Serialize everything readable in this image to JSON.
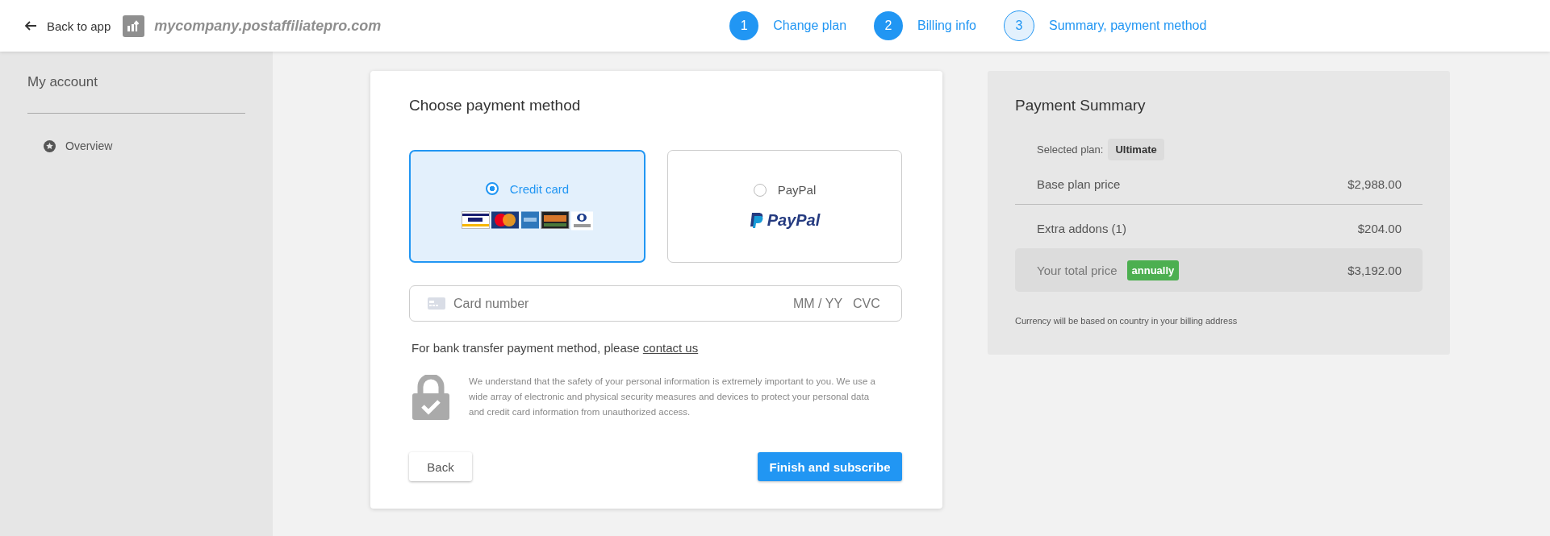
{
  "header": {
    "back_label": "Back to app",
    "site": "mycompany.postaffiliatepro.com",
    "steps": [
      {
        "number": "1",
        "label": "Change plan",
        "kind": "done"
      },
      {
        "number": "2",
        "label": "Billing info",
        "kind": "done"
      },
      {
        "number": "3",
        "label": "Summary, payment method",
        "kind": "current"
      }
    ]
  },
  "sidebar": {
    "title": "My account",
    "items": [
      {
        "label": "Overview",
        "selected": false
      }
    ]
  },
  "payment": {
    "title": "Choose payment method",
    "methods": [
      {
        "label": "Credit card",
        "kind": "cards",
        "selected": true
      },
      {
        "label": "PayPal",
        "kind": "paypal",
        "logo_text": "PayPal",
        "selected": false
      }
    ],
    "card_field": {
      "placeholder": "Card number",
      "expiry_placeholder": "MM / YY",
      "cvc_placeholder": "CVC"
    },
    "bank_note": "For bank transfer payment method, please ",
    "bank_link": "contact us",
    "security_text": "We understand that the safety of your personal information is extremely important to you. We use a wide array of electronic and physical security measures and devices to protect your personal data and credit card information from unauthorized access.",
    "back_button": "Back",
    "finish_button": "Finish and subscribe"
  },
  "summary": {
    "title": "Payment Summary",
    "plan_label": "Selected plan:",
    "plan": "Ultimate",
    "rows": [
      {
        "label": "Base plan price",
        "value": "$2,988.00"
      },
      {
        "label": "Extra addons (1)",
        "value": "$204.00"
      }
    ],
    "total_label": "Your total price",
    "period": "annually",
    "total": "$3,192.00",
    "note": "Currency will be based on country in your billing address"
  }
}
